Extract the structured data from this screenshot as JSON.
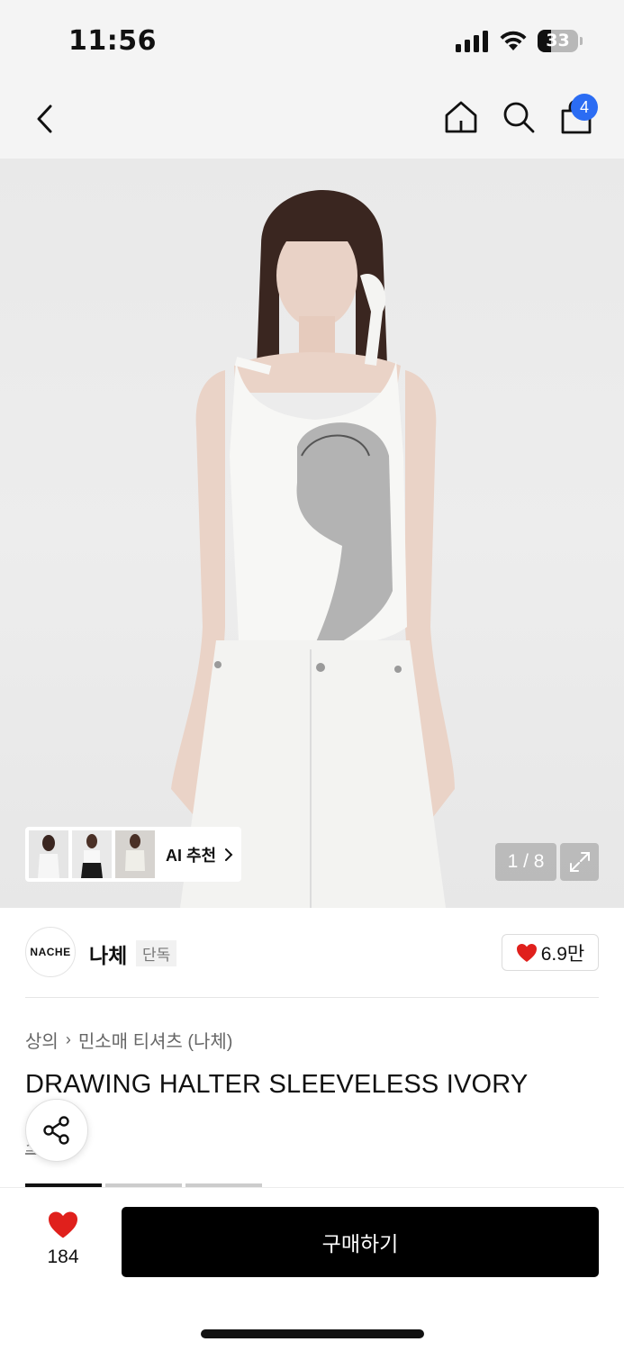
{
  "status_bar": {
    "time": "11:56",
    "battery": "33",
    "icons": [
      "signal-icon",
      "wifi-icon",
      "battery-icon"
    ]
  },
  "nav": {
    "icons": [
      "chevron-left-icon",
      "home-icon",
      "search-icon",
      "shopping-bag-icon"
    ],
    "cart_count": "4",
    "badge_color": "#2b6cf3"
  },
  "gallery": {
    "ai_recommend_label": "AI 추천",
    "page_indicator": "1 / 8",
    "expand_icon": "expand-icon"
  },
  "brand": {
    "logo_text": "NACHE",
    "name": "나체",
    "badge": "단독",
    "likes": "6.9만",
    "heart_color": "#e0201c"
  },
  "breadcrumb": [
    "상의",
    "민소매 티셔츠 (나체)"
  ],
  "product": {
    "title": "DRAWING HALTER SLEEVELESS IVORY",
    "partial_text": "소개"
  },
  "bottom": {
    "wish_count": "184",
    "buy_label": "구매하기"
  }
}
